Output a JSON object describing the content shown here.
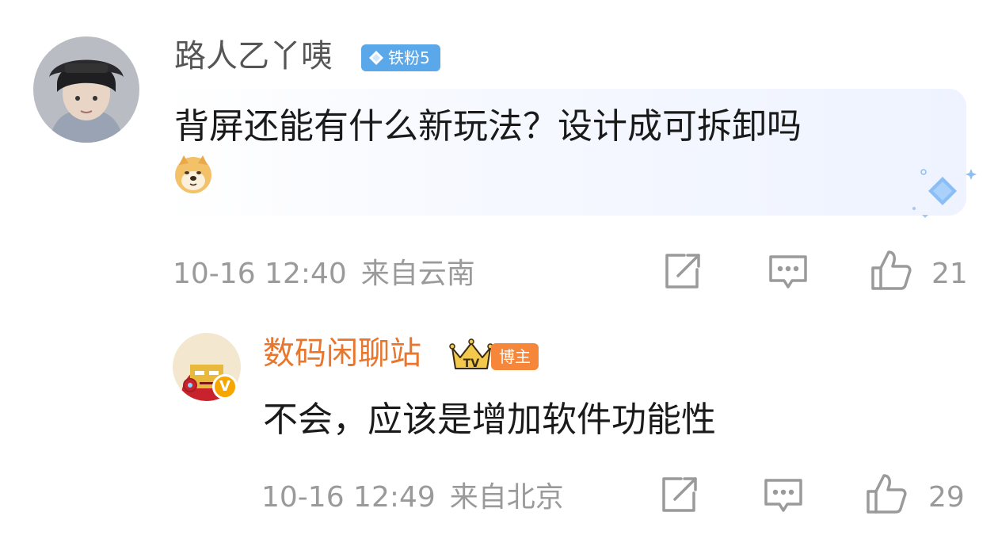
{
  "comments": [
    {
      "username": "路人乙丫咦",
      "fan_badge": "铁粉5",
      "text": "背屏还能有什么新玩法？设计成可拆卸吗",
      "emoji_icon": "doge-icon",
      "timestamp": "10-16 12:40",
      "location": "来自云南",
      "likes": "21"
    },
    {
      "username": "数码闲聊站",
      "badge": "博主",
      "crown_text": "TV",
      "verified_mark": "V",
      "text": "不会，应该是增加软件功能性",
      "timestamp": "10-16 12:49",
      "location": "来自北京",
      "likes": "29"
    }
  ],
  "colors": {
    "username_default": "#555555",
    "username_blogger": "#e8762d",
    "fan_badge_bg": "#5aa8ea",
    "blogger_badge_bg": "#f5863a",
    "meta_text": "#9a9a9a"
  },
  "icons": [
    "share-icon",
    "comment-icon",
    "like-icon"
  ]
}
